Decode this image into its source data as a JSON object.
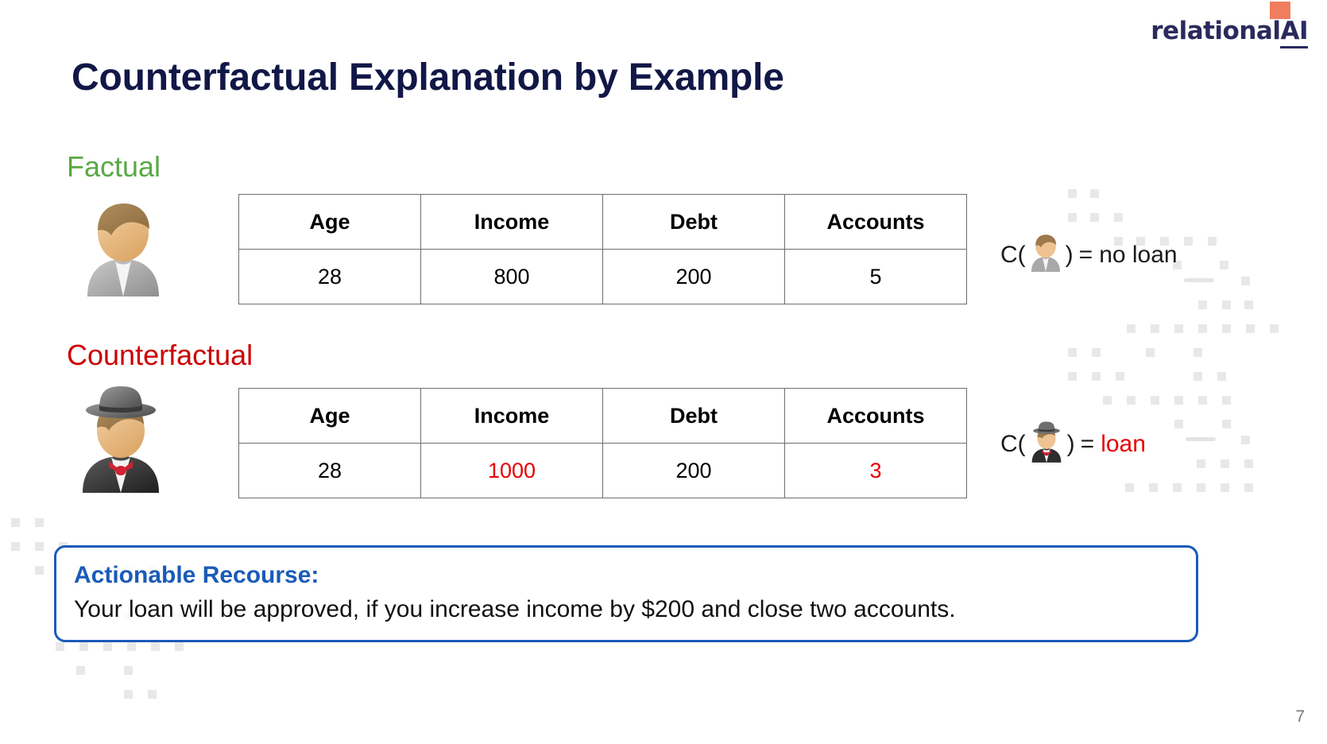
{
  "logo": {
    "text_main": "relational",
    "text_accent": "AI",
    "square_color": "#ef7d5e",
    "text_color": "#2a2a5e"
  },
  "slide": {
    "title": "Counterfactual Explanation by Example",
    "title_color": "#111747",
    "page_number": "7"
  },
  "sections": {
    "factual": {
      "label": "Factual",
      "label_color": "#5aa845",
      "avatar_icon": "person-avatar-icon"
    },
    "counterfactual": {
      "label": "Counterfactual",
      "label_color": "#cc0000",
      "avatar_icon": "person-tophat-avatar-icon"
    }
  },
  "tables": {
    "factual": {
      "headers": [
        "Age",
        "Income",
        "Debt",
        "Accounts"
      ],
      "rows": [
        {
          "cells": [
            {
              "value": "28",
              "changed": false
            },
            {
              "value": "800",
              "changed": false
            },
            {
              "value": "200",
              "changed": false
            },
            {
              "value": "5",
              "changed": false
            }
          ]
        }
      ]
    },
    "counterfactual": {
      "headers": [
        "Age",
        "Income",
        "Debt",
        "Accounts"
      ],
      "rows": [
        {
          "cells": [
            {
              "value": "28",
              "changed": false
            },
            {
              "value": "1000",
              "changed": true
            },
            {
              "value": "200",
              "changed": false
            },
            {
              "value": "3",
              "changed": true
            }
          ]
        }
      ]
    },
    "changed_value_color": "#e60000"
  },
  "formulas": {
    "factual": {
      "prefix": "C(",
      "suffix": ")",
      "equals": "=",
      "result": "no loan",
      "result_color": "#1a1a1a"
    },
    "counterfactual": {
      "prefix": "C(",
      "suffix": ")",
      "equals": "=",
      "result": "loan",
      "result_color": "#e60000"
    }
  },
  "recourse": {
    "title": "Actionable Recourse:",
    "title_color": "#1a5bb8",
    "body": "Your loan will be approved, if you increase income by $200 and close two accounts.",
    "border_color": "#1a5bb8"
  },
  "decor": {
    "dot_color": "#e8e8e8"
  }
}
